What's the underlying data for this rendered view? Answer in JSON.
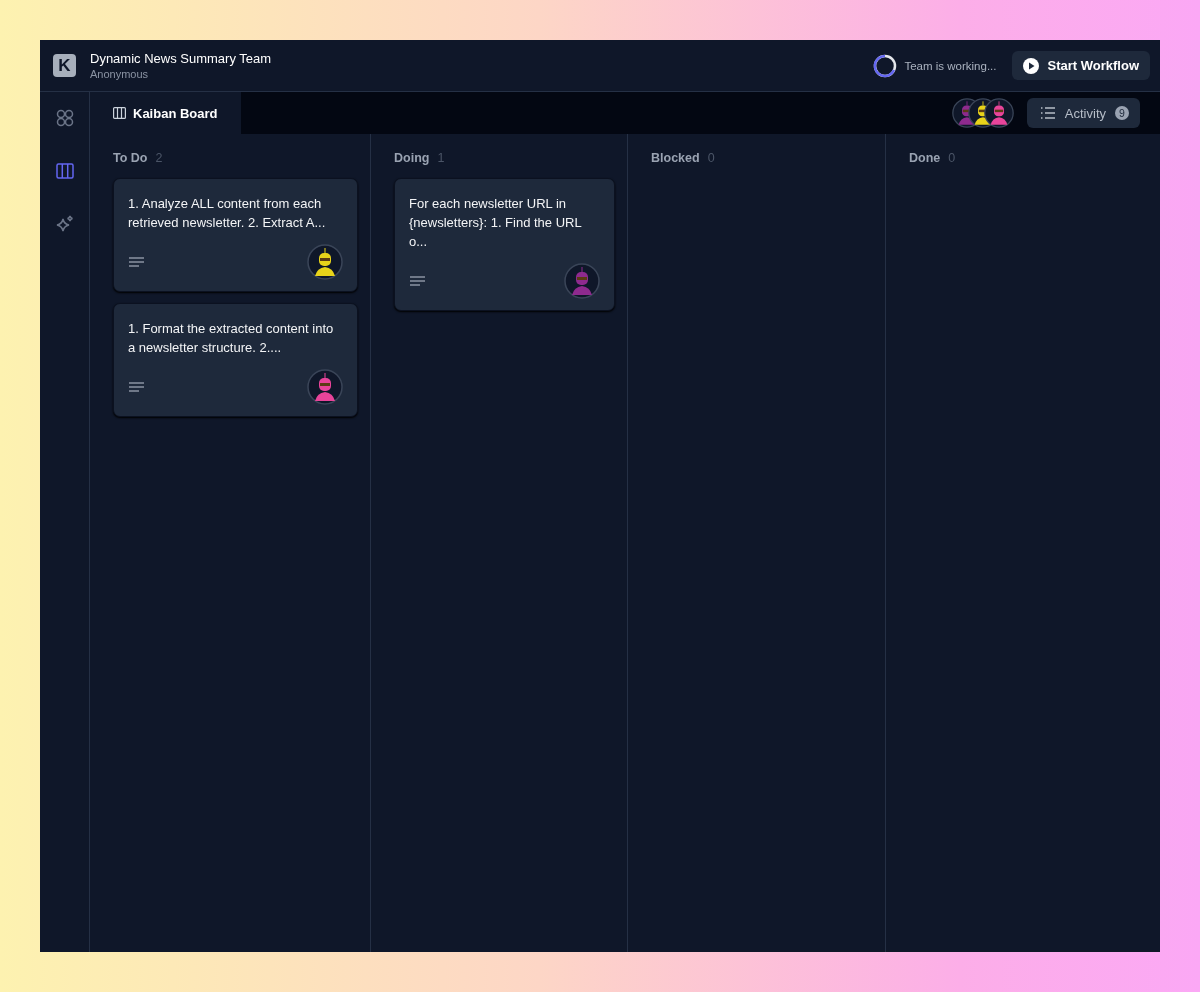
{
  "header": {
    "logo": "K",
    "title": "Dynamic News Summary Team",
    "subtitle": "Anonymous",
    "status": "Team is working...",
    "start_button": "Start Workflow"
  },
  "sidebar": {
    "items": [
      {
        "kind": "grid",
        "selected": false
      },
      {
        "kind": "board",
        "selected": true
      },
      {
        "kind": "sparkle",
        "selected": false
      }
    ]
  },
  "tabs": [
    {
      "label": "Kaiban Board",
      "selected": true
    }
  ],
  "team_avatars": [
    {
      "color": "#8e2a8e"
    },
    {
      "color": "#e8d31a"
    },
    {
      "color": "#e8449a"
    }
  ],
  "activity": {
    "label": "Activity",
    "count": "9"
  },
  "columns": [
    {
      "title": "To Do",
      "count": "2",
      "cards": [
        {
          "text": "1. Analyze ALL content from each retrieved newsletter. 2. Extract A...",
          "color": "#e8d31a"
        },
        {
          "text": "1. Format the extracted content into a newsletter structure. 2....",
          "color": "#e8449a"
        }
      ]
    },
    {
      "title": "Doing",
      "count": "1",
      "cards": [
        {
          "text": "For each newsletter URL in {newsletters}: 1. Find the URL o...",
          "color": "#8e2a8e"
        }
      ]
    },
    {
      "title": "Blocked",
      "count": "0"
    },
    {
      "title": "Done",
      "count": "0"
    }
  ]
}
